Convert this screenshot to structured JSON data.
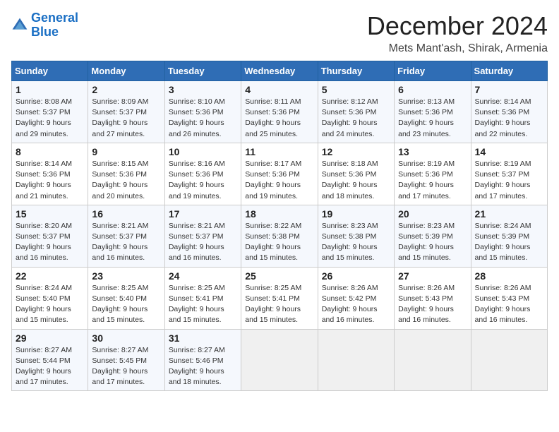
{
  "logo": {
    "line1": "General",
    "line2": "Blue"
  },
  "title": "December 2024",
  "subtitle": "Mets Mant'ash, Shirak, Armenia",
  "header_days": [
    "Sunday",
    "Monday",
    "Tuesday",
    "Wednesday",
    "Thursday",
    "Friday",
    "Saturday"
  ],
  "weeks": [
    [
      {
        "day": "1",
        "sunrise": "Sunrise: 8:08 AM",
        "sunset": "Sunset: 5:37 PM",
        "daylight": "Daylight: 9 hours and 29 minutes."
      },
      {
        "day": "2",
        "sunrise": "Sunrise: 8:09 AM",
        "sunset": "Sunset: 5:37 PM",
        "daylight": "Daylight: 9 hours and 27 minutes."
      },
      {
        "day": "3",
        "sunrise": "Sunrise: 8:10 AM",
        "sunset": "Sunset: 5:36 PM",
        "daylight": "Daylight: 9 hours and 26 minutes."
      },
      {
        "day": "4",
        "sunrise": "Sunrise: 8:11 AM",
        "sunset": "Sunset: 5:36 PM",
        "daylight": "Daylight: 9 hours and 25 minutes."
      },
      {
        "day": "5",
        "sunrise": "Sunrise: 8:12 AM",
        "sunset": "Sunset: 5:36 PM",
        "daylight": "Daylight: 9 hours and 24 minutes."
      },
      {
        "day": "6",
        "sunrise": "Sunrise: 8:13 AM",
        "sunset": "Sunset: 5:36 PM",
        "daylight": "Daylight: 9 hours and 23 minutes."
      },
      {
        "day": "7",
        "sunrise": "Sunrise: 8:14 AM",
        "sunset": "Sunset: 5:36 PM",
        "daylight": "Daylight: 9 hours and 22 minutes."
      }
    ],
    [
      {
        "day": "8",
        "sunrise": "Sunrise: 8:14 AM",
        "sunset": "Sunset: 5:36 PM",
        "daylight": "Daylight: 9 hours and 21 minutes."
      },
      {
        "day": "9",
        "sunrise": "Sunrise: 8:15 AM",
        "sunset": "Sunset: 5:36 PM",
        "daylight": "Daylight: 9 hours and 20 minutes."
      },
      {
        "day": "10",
        "sunrise": "Sunrise: 8:16 AM",
        "sunset": "Sunset: 5:36 PM",
        "daylight": "Daylight: 9 hours and 19 minutes."
      },
      {
        "day": "11",
        "sunrise": "Sunrise: 8:17 AM",
        "sunset": "Sunset: 5:36 PM",
        "daylight": "Daylight: 9 hours and 19 minutes."
      },
      {
        "day": "12",
        "sunrise": "Sunrise: 8:18 AM",
        "sunset": "Sunset: 5:36 PM",
        "daylight": "Daylight: 9 hours and 18 minutes."
      },
      {
        "day": "13",
        "sunrise": "Sunrise: 8:19 AM",
        "sunset": "Sunset: 5:36 PM",
        "daylight": "Daylight: 9 hours and 17 minutes."
      },
      {
        "day": "14",
        "sunrise": "Sunrise: 8:19 AM",
        "sunset": "Sunset: 5:37 PM",
        "daylight": "Daylight: 9 hours and 17 minutes."
      }
    ],
    [
      {
        "day": "15",
        "sunrise": "Sunrise: 8:20 AM",
        "sunset": "Sunset: 5:37 PM",
        "daylight": "Daylight: 9 hours and 16 minutes."
      },
      {
        "day": "16",
        "sunrise": "Sunrise: 8:21 AM",
        "sunset": "Sunset: 5:37 PM",
        "daylight": "Daylight: 9 hours and 16 minutes."
      },
      {
        "day": "17",
        "sunrise": "Sunrise: 8:21 AM",
        "sunset": "Sunset: 5:37 PM",
        "daylight": "Daylight: 9 hours and 16 minutes."
      },
      {
        "day": "18",
        "sunrise": "Sunrise: 8:22 AM",
        "sunset": "Sunset: 5:38 PM",
        "daylight": "Daylight: 9 hours and 15 minutes."
      },
      {
        "day": "19",
        "sunrise": "Sunrise: 8:23 AM",
        "sunset": "Sunset: 5:38 PM",
        "daylight": "Daylight: 9 hours and 15 minutes."
      },
      {
        "day": "20",
        "sunrise": "Sunrise: 8:23 AM",
        "sunset": "Sunset: 5:39 PM",
        "daylight": "Daylight: 9 hours and 15 minutes."
      },
      {
        "day": "21",
        "sunrise": "Sunrise: 8:24 AM",
        "sunset": "Sunset: 5:39 PM",
        "daylight": "Daylight: 9 hours and 15 minutes."
      }
    ],
    [
      {
        "day": "22",
        "sunrise": "Sunrise: 8:24 AM",
        "sunset": "Sunset: 5:40 PM",
        "daylight": "Daylight: 9 hours and 15 minutes."
      },
      {
        "day": "23",
        "sunrise": "Sunrise: 8:25 AM",
        "sunset": "Sunset: 5:40 PM",
        "daylight": "Daylight: 9 hours and 15 minutes."
      },
      {
        "day": "24",
        "sunrise": "Sunrise: 8:25 AM",
        "sunset": "Sunset: 5:41 PM",
        "daylight": "Daylight: 9 hours and 15 minutes."
      },
      {
        "day": "25",
        "sunrise": "Sunrise: 8:25 AM",
        "sunset": "Sunset: 5:41 PM",
        "daylight": "Daylight: 9 hours and 15 minutes."
      },
      {
        "day": "26",
        "sunrise": "Sunrise: 8:26 AM",
        "sunset": "Sunset: 5:42 PM",
        "daylight": "Daylight: 9 hours and 16 minutes."
      },
      {
        "day": "27",
        "sunrise": "Sunrise: 8:26 AM",
        "sunset": "Sunset: 5:43 PM",
        "daylight": "Daylight: 9 hours and 16 minutes."
      },
      {
        "day": "28",
        "sunrise": "Sunrise: 8:26 AM",
        "sunset": "Sunset: 5:43 PM",
        "daylight": "Daylight: 9 hours and 16 minutes."
      }
    ],
    [
      {
        "day": "29",
        "sunrise": "Sunrise: 8:27 AM",
        "sunset": "Sunset: 5:44 PM",
        "daylight": "Daylight: 9 hours and 17 minutes."
      },
      {
        "day": "30",
        "sunrise": "Sunrise: 8:27 AM",
        "sunset": "Sunset: 5:45 PM",
        "daylight": "Daylight: 9 hours and 17 minutes."
      },
      {
        "day": "31",
        "sunrise": "Sunrise: 8:27 AM",
        "sunset": "Sunset: 5:46 PM",
        "daylight": "Daylight: 9 hours and 18 minutes."
      },
      null,
      null,
      null,
      null
    ]
  ]
}
